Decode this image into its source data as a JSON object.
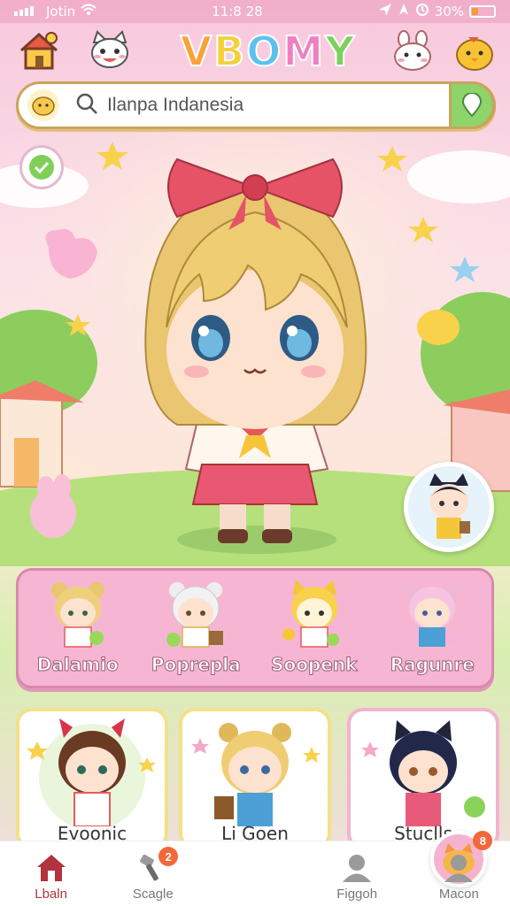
{
  "status_bar": {
    "carrier": "Jotin",
    "time": "11:8 28",
    "battery_percent": "30%",
    "battery_level": 0.3
  },
  "header": {
    "logo_letters": [
      "V",
      "B",
      "O",
      "M",
      "Y"
    ],
    "icons": [
      "home-icon",
      "cat-mascot-icon",
      "bunny-mascot-icon",
      "chick-mascot-icon"
    ]
  },
  "search": {
    "text": "Ilanpa Indanesia"
  },
  "panel_characters": [
    {
      "name": "Dalamio"
    },
    {
      "name": "Poprepla"
    },
    {
      "name": "Soopenk"
    },
    {
      "name": "Ragunre"
    }
  ],
  "cards": [
    {
      "name": "Evoonic"
    },
    {
      "name": "Li Goen"
    },
    {
      "name": "Stuclls"
    }
  ],
  "tabs": [
    {
      "label": "Lbaln",
      "icon": "home-icon",
      "active": true
    },
    {
      "label": "Scagle",
      "icon": "tools-icon",
      "badge": "2"
    },
    {
      "label": "",
      "icon": "cat-center-icon",
      "badge": "8"
    },
    {
      "label": "Figgoh",
      "icon": "user-icon"
    },
    {
      "label": "Macon",
      "icon": "user-icon"
    }
  ],
  "colors": {
    "accent_pink": "#f6b6d3",
    "active_tab": "#b2333d",
    "badge": "#f2683a"
  }
}
